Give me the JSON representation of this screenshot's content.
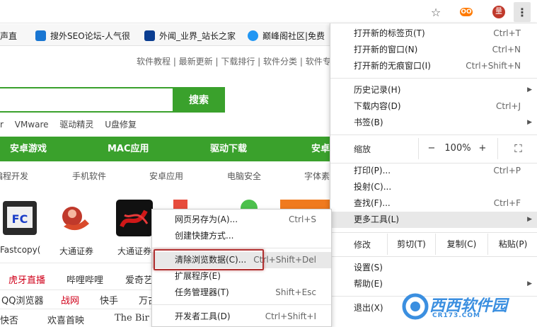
{
  "toolbar": {
    "star_glyph": "☆",
    "ext_label": "OO",
    "avatar_label": "量",
    "menu_glyph": "⋮"
  },
  "bookmarks": [
    {
      "label": "声声直",
      "color": "#7b4fa0"
    },
    {
      "label": "搜外SEO论坛-人气很",
      "color": "#1976d2"
    },
    {
      "label": "外闻_业界_站长之家",
      "color": "#0a3d91"
    },
    {
      "label": "巅峰阁社区|免费",
      "color": "#2196f3"
    }
  ],
  "page": {
    "toplinks": "软件教程 | 最新更新 | 下载排行 | 软件分类 | 软件专题",
    "search_button": "搜索",
    "hotwords": [
      "r",
      "VMware",
      "驱动精灵",
      "U盘修复"
    ],
    "green_nav": [
      "安卓游戏",
      "MAC应用",
      "驱动下载",
      "安卓"
    ],
    "sub_nav": [
      "编程开发",
      "手机软件",
      "安卓应用",
      "电脑安全",
      "字体素材"
    ],
    "apps": [
      "Fastcopy(",
      "大通证券",
      "大通证券"
    ],
    "row1": [
      "虎牙直播",
      "哔哩哔哩",
      "爱奇艺"
    ],
    "row2": [
      "QQ浏览器",
      "战网",
      "快手",
      "万古"
    ],
    "row3": [
      "快否",
      "欢喜首映",
      "The Bir"
    ]
  },
  "main_menu": {
    "items": [
      {
        "label": "打开新的标签页(T)",
        "shortcut": "Ctrl+T"
      },
      {
        "label": "打开新的窗口(N)",
        "shortcut": "Ctrl+N"
      },
      {
        "label": "打开新的无痕窗口(I)",
        "shortcut": "Ctrl+Shift+N"
      },
      {
        "label": "历史记录(H)",
        "shortcut": ""
      },
      {
        "label": "下载内容(D)",
        "shortcut": "Ctrl+J"
      },
      {
        "label": "书签(B)",
        "shortcut": ""
      }
    ],
    "zoom": {
      "label": "缩放",
      "minus": "−",
      "value": "100%",
      "plus": "+",
      "fullscreen": "⛶"
    },
    "items2": [
      {
        "label": "打印(P)...",
        "shortcut": "Ctrl+P"
      },
      {
        "label": "投射(C)...",
        "shortcut": ""
      },
      {
        "label": "查找(F)...",
        "shortcut": "Ctrl+F"
      },
      {
        "label": "更多工具(L)",
        "shortcut": ""
      }
    ],
    "edit": {
      "label": "修改",
      "cut": "剪切(T)",
      "copy": "复制(C)",
      "paste": "粘贴(P)"
    },
    "items3": [
      {
        "label": "设置(S)"
      },
      {
        "label": "帮助(E)"
      },
      {
        "label": "退出(X)"
      }
    ],
    "arrow_glyph": "▶"
  },
  "sub_menu": {
    "items": [
      {
        "label": "网页另存为(A)...",
        "shortcut": "Ctrl+S"
      },
      {
        "label": "创建快捷方式...",
        "shortcut": ""
      },
      {
        "label": "清除浏览数据(C)...",
        "shortcut": "Ctrl+Shift+Del"
      },
      {
        "label": "扩展程序(E)",
        "shortcut": ""
      },
      {
        "label": "任务管理器(T)",
        "shortcut": "Shift+Esc"
      },
      {
        "label": "开发者工具(D)",
        "shortcut": "Ctrl+Shift+I"
      }
    ]
  },
  "watermark": {
    "text": "西西软件园",
    "sub": "CR173.COM"
  }
}
